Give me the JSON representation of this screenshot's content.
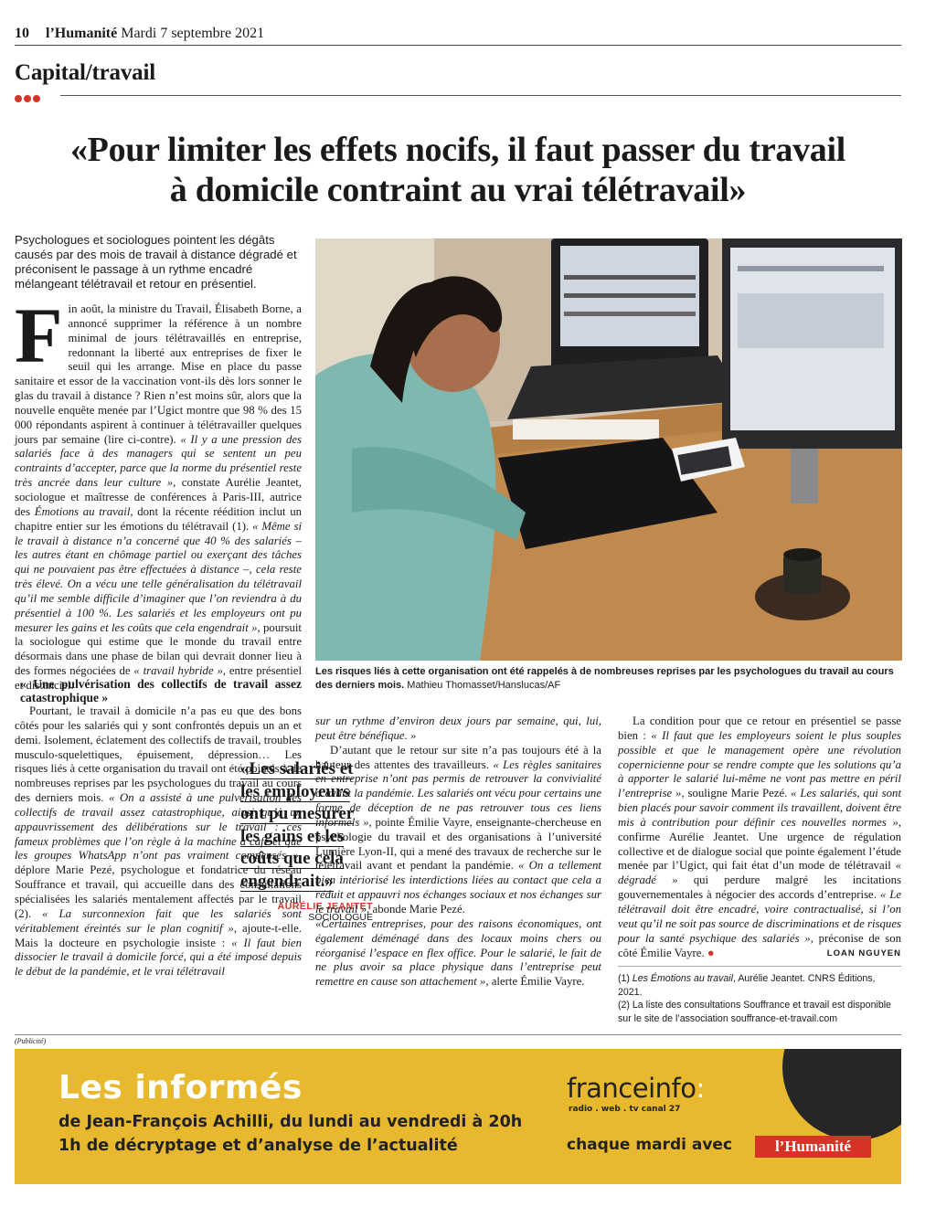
{
  "header": {
    "page_number": "10",
    "brand": "l’Humanité",
    "date": "Mardi 7 septembre 2021"
  },
  "section": {
    "title": "Capital/travail"
  },
  "headline": {
    "line1": "«Pour limiter les effets nocifs, il faut passer du travail",
    "line2": "à domicile contraint au vrai télétravail»"
  },
  "chapo": "Psychologues et sociologues pointent les dégâts causés par des mois de travail à distance dégradé et préconisent le passage à un rythme encadré mélangeant télétravail et retour en présentiel.",
  "col1": {
    "dropcap": "F",
    "p1": "in août, la ministre du Travail, Élisabeth Borne, a annoncé supprimer la référence à un nombre minimal de jours télétravaillés en entreprise, redonnant la liberté aux entreprises de fixer le seuil qui les arrange. Mise en place du passe sanitaire et essor de la vaccination vont-ils dès lors sonner le glas du travail à distance ? Rien n’est moins sûr, alors que la nouvelle enquête menée par l’Ugict montre que 98 % des 15 000 répondants aspirent à continuer à télétravailler quelques jours par semaine (lire ci-contre). ",
    "p1_q1": "« Il y a une pression des salariés face à des managers qui se sentent un peu contraints d’accepter, parce que la norme du présentiel reste très ancrée dans leur culture »",
    "p1_b": ", constate Aurélie Jeantet, sociologue et maîtresse de conférences à Paris-III, autrice des ",
    "p1_book": "Émotions au travail,",
    "p1_c": " dont la récente réédition inclut un chapitre entier sur les émotions du télétravail (1). ",
    "p1_q2": "« Même si le travail à distance n’a concerné que 40 % des salariés – les autres étant en chômage partiel ou exerçant des tâches qui ne pouvaient pas être effectuées à distance –, cela reste très élevé. On a vécu une telle généralisation du télétravail qu’il me semble difficile d’imaginer que l’on reviendra à du présentiel à 100 %. Les salariés et les employeurs ont pu mesurer les gains et les coûts que cela engendrait »",
    "p1_d": ", poursuit la sociologue qui estime que le monde du travail entre désormais dans une phase de bilan qui devrait donner lieu à des formes négociées de ",
    "p1_q3": "« travail hybride »",
    "p1_e": ", entre présentiel et distanciel."
  },
  "photo": {
    "caption_bold": "Les risques liés à cette organisation ont été rappelés à de nombreuses reprises par les psychologues du travail au cours des derniers mois.",
    "credit": " Mathieu Thomasset/Hanslucas/AF"
  },
  "col2": {
    "intertitle": "« Une pulvérisation des collectifs de travail assez catastrophique »",
    "p1": "Pourtant, le travail à domicile n’a pas eu que des bons côtés pour les salariés qui y sont confrontés depuis un an et demi. Isolement, éclatement des collectifs de travail, troubles musculo-squelettiques, épuisement, dépression… Les risques liés à cette organisation du travail ont été pointés à de nombreuses reprises par les psychologues du travail au cours des derniers mois. ",
    "q1": "« On a assisté à une pulvérisation des collectifs de travail assez catastrophique, ainsi qu’à un appauvrissement des délibérations sur le travail : ces fameux problèmes que l’on règle à la machine à café et que les groupes WhatsApp n’ont pas vraiment compensés »",
    "p2": ", déplore Marie Pezé, psychologue et fondatrice du réseau Souffrance et travail, qui accueille dans des consultations spécialisées les salariés mentalement affectés par le travail (2). ",
    "q2": "« La surconnexion fait que les salariés sont véritablement éreintés sur le plan cognitif »",
    "p3": ", ajoute-t-elle. Mais la docteure en psychologie insiste : ",
    "q3": "« Il faut bien dissocier le travail à domicile forcé, qui a été imposé depuis le début de la pandémie, et le vrai télétravail"
  },
  "pullquote": {
    "text": "«Les salariés et les employeurs ont pu mesurer les gains et les coûts que cela engendrait.»",
    "author": "AURÉLIE JEANTET",
    "role": "SOCIOLOGUE"
  },
  "col3": {
    "q_top": "sur un rythme d’environ deux jours par semaine, qui, lui, peut être bénéfique. »",
    "p1": "D’autant que le retour sur site n’a pas toujours été à la hauteur des attentes des travailleurs. ",
    "q1": "« Les règles sanitaires en entreprise n’ont pas permis de retrouver la convivialité d’avant la pandémie. Les salariés ont vécu pour certains une forme de déception de ne pas retrouver tous ces liens informels »",
    "p2": ", pointe Émilie Vayre, enseignante-chercheuse en psychologie du travail et des organisations à l’université Lumière Lyon-II, qui a mené des travaux de recherche sur le télétravail avant et pendant la pandémie. ",
    "q2": "« On a tellement bien intériorisé les interdictions liées au contact que cela a réduit et appauvri nos échanges sociaux et nos échanges sur le travail »",
    "p3": ", abonde Marie Pezé. ",
    "q3": "«Certaines entreprises, pour des raisons économiques, ont également déménagé dans des locaux moins chers ou réorganisé l’espace en flex office. Pour le salarié, le fait de ne plus avoir sa place physique dans l’entreprise peut remettre en cause son attachement »",
    "p4": ", alerte Émilie Vayre."
  },
  "col4": {
    "p1": "La condition pour que ce retour en présentiel se passe bien : ",
    "q1": "« Il faut que les employeurs soient le plus souples possible et que le management opère une révolution copernicienne pour se rendre compte que les solutions qu’a à apporter le salarié lui-même ne vont pas mettre en péril l’entreprise »",
    "p2": ", souligne Marie Pezé. ",
    "q2": "« Les salariés, qui sont bien placés pour savoir comment ils travaillent, doivent être mis à contribution pour définir ces nouvelles normes »",
    "p3": ", confirme Aurélie Jeantet. Une urgence de régulation collective et de dialogue social que pointe également l’étude menée par l’Ugict, qui fait état d’un mode de télétravail ",
    "q3": "« dégradé »",
    "p4": " qui perdure malgré les incitations gouvernementales à négocier des accords d’entreprise. ",
    "q4": "« Le télétravail doit être encadré, voire contractualisé, si l’on veut qu’il ne soit pas source de discriminations et de risques pour la santé psychique des salariés »",
    "p5": ", préconise de son côté Émilie Vayre.",
    "end": " ●",
    "signature": "LOAN NGUYEN",
    "note1_a": "(1) ",
    "note1_b": "Les Émotions au travail",
    "note1_c": ", Aurélie Jeantet. CNRS Éditions, 2021.",
    "note2": "(2) La liste des consultations Souffrance et travail est disponible sur le site de l’association souffrance-et-travail.com"
  },
  "ad": {
    "publicite": "(Publicité)",
    "title": "Les informés",
    "line1": "de Jean-François Achilli, du lundi au vendredi à 20h",
    "line2": "1h de décryptage et d’analyse de l’actualité",
    "brand": "franceinfo",
    "brand_colon": ":",
    "brand_sub": "radio . web . tv canal 27",
    "tuesday": "chaque mardi avec",
    "logo": "l’Humanité",
    "colors": {
      "background": "#e8b92f",
      "logo": "#d63327",
      "circle": "#262626"
    }
  }
}
